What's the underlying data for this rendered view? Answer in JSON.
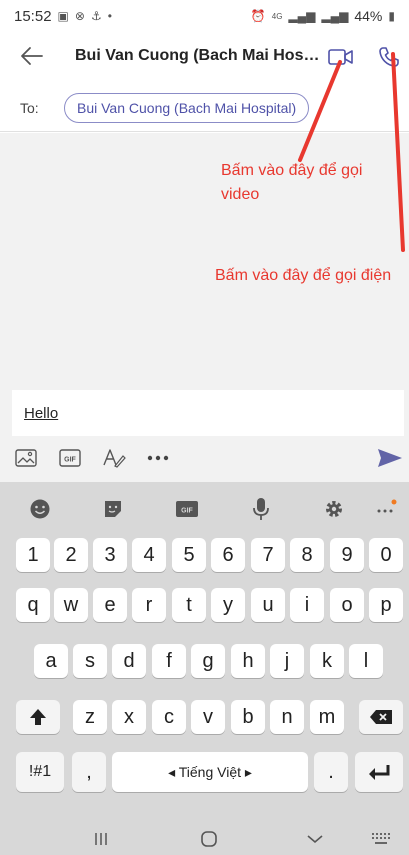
{
  "status_bar": {
    "time": "15:52",
    "battery": "44%",
    "network": "4G"
  },
  "header": {
    "title": "Bui Van Cuong (Bach Mai Hospital)"
  },
  "to_row": {
    "label": "To:",
    "recipient": "Bui Van Cuong (Bach Mai Hospital)"
  },
  "annotations": {
    "video": "Bấm vào đây để gọi video",
    "call": "Bấm vào đây để gọi điện",
    "color": "#e8382f"
  },
  "compose": {
    "message": "Hello",
    "send_color": "#6264a7"
  },
  "keyboard": {
    "numbers": [
      "1",
      "2",
      "3",
      "4",
      "5",
      "6",
      "7",
      "8",
      "9",
      "0"
    ],
    "row1": [
      "q",
      "w",
      "e",
      "r",
      "t",
      "y",
      "u",
      "i",
      "o",
      "p"
    ],
    "row2": [
      "a",
      "s",
      "d",
      "f",
      "g",
      "h",
      "j",
      "k",
      "l"
    ],
    "row3": [
      "z",
      "x",
      "c",
      "v",
      "b",
      "n",
      "m"
    ],
    "symbols_label": "!#1",
    "comma": ",",
    "period": ".",
    "space_label": "◂ Tiếng Việt ▸"
  }
}
